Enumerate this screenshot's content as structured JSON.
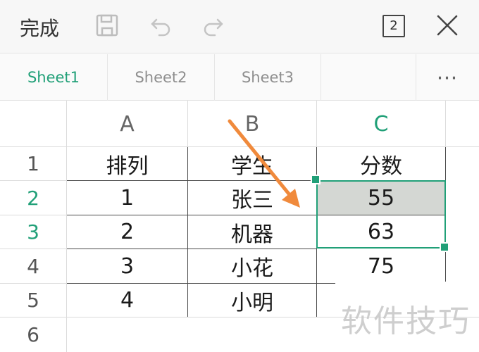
{
  "toolbar": {
    "done_label": "完成",
    "page_count": "2",
    "icons": [
      "save-icon",
      "undo-icon",
      "redo-icon",
      "close-icon"
    ]
  },
  "tabs": [
    {
      "label": "Sheet1",
      "active": true
    },
    {
      "label": "Sheet2",
      "active": false
    },
    {
      "label": "Sheet3",
      "active": false
    }
  ],
  "tabs_more": "⋯",
  "columns": [
    "A",
    "B",
    "C"
  ],
  "rows": [
    "1",
    "2",
    "3",
    "4",
    "5",
    "6"
  ],
  "cells": [
    [
      "排列",
      "学生",
      "分数"
    ],
    [
      "1",
      "张三",
      "55"
    ],
    [
      "2",
      "机器",
      "63"
    ],
    [
      "3",
      "小花",
      "75"
    ],
    [
      "4",
      "小明",
      ""
    ],
    [
      "",
      "",
      ""
    ]
  ],
  "selection": {
    "range": "C2:C3",
    "active_column": "C",
    "active_rows": [
      "2",
      "3"
    ]
  },
  "colors": {
    "accent": "#21a078",
    "arrow": "#f08a3c",
    "selected_fill": "#d4d7d3"
  },
  "watermark": "软件技巧"
}
